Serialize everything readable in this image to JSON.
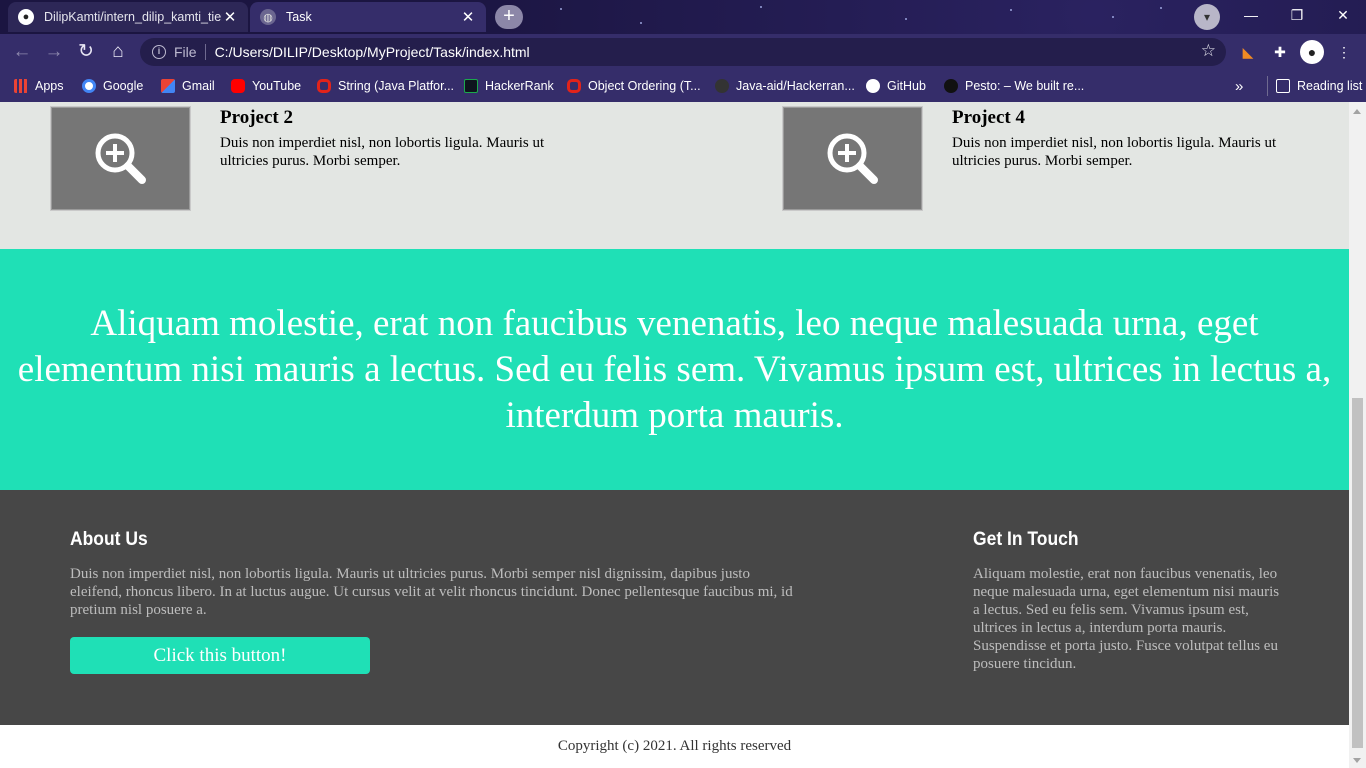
{
  "browser": {
    "tabs": [
      {
        "title": "DilipKamti/intern_dilip_kamti_tier",
        "close": "✕"
      },
      {
        "title": "Task",
        "close": "✕"
      }
    ],
    "new_tab": "+",
    "window_controls": {
      "minimize": "—",
      "restore": "❐",
      "close": "✕"
    },
    "address": {
      "info": "i",
      "scheme_label": "File",
      "url": "C:/Users/DILIP/Desktop/MyProject/Task/index.html"
    },
    "bookmarks": [
      {
        "label": "Apps",
        "icon": "apps-grid-icon",
        "color": "#ea4335"
      },
      {
        "label": "Google",
        "icon": "google-icon",
        "color": "#4285f4"
      },
      {
        "label": "Gmail",
        "icon": "gmail-icon",
        "color": "#ea4335"
      },
      {
        "label": "YouTube",
        "icon": "youtube-icon",
        "color": "#ff0000"
      },
      {
        "label": "String (Java Platfor...",
        "icon": "oracle-icon",
        "color": "#e2231a"
      },
      {
        "label": "HackerRank",
        "icon": "hackerrank-icon",
        "color": "#1ba94c"
      },
      {
        "label": "Object Ordering (T...",
        "icon": "oracle-icon",
        "color": "#e2231a"
      },
      {
        "label": "Java-aid/Hackerran...",
        "icon": "github-icon",
        "color": "#333333"
      },
      {
        "label": "GitHub",
        "icon": "github-icon",
        "color": "#ffffff"
      },
      {
        "label": "Pesto: – We built re...",
        "icon": "pesto-icon",
        "color": "#111111"
      }
    ],
    "bookmarks_more": "»",
    "reading_list": "Reading list"
  },
  "projects": [
    {
      "title": "Project 2",
      "description": "Duis non imperdiet nisl, non lobortis ligula. Mauris ut ultricies purus. Morbi semper."
    },
    {
      "title": "Project 4",
      "description": "Duis non imperdiet nisl, non lobortis ligula. Mauris ut ultricies purus. Morbi semper."
    }
  ],
  "quote": "Aliquam molestie, erat non faucibus venenatis, leo neque malesuada urna, eget elementum nisi mauris a lectus. Sed eu felis sem. Vivamus ipsum est, ultrices in lectus a, interdum porta mauris.",
  "footer": {
    "about": {
      "heading": "About Us",
      "text": "Duis non imperdiet nisl, non lobortis ligula. Mauris ut ultricies purus. Morbi semper nisl dignissim, dapibus justo eleifend, rhoncus libero. In at luctus augue. Ut cursus velit at velit rhoncus tincidunt. Donec pellentesque faucibus mi, id pretium nisl posuere a.",
      "button": "Click this button!"
    },
    "contact": {
      "heading": "Get In Touch",
      "text": "Aliquam molestie, erat non faucibus venenatis, leo neque malesuada urna, eget elementum nisi mauris a lectus. Sed eu felis sem. Vivamus ipsum est, ultrices in lectus a, interdum porta mauris. Suspendisse et porta justo. Fusce volutpat tellus eu posuere tincidun."
    }
  },
  "copyright": "Copyright (c) 2021. All rights reserved",
  "colors": {
    "accent": "#1fe0b6",
    "footer_bg": "#474747",
    "projects_bg": "#e3e6e3"
  }
}
